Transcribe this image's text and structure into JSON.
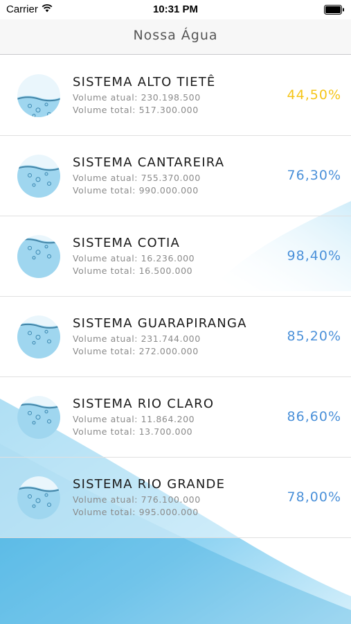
{
  "status_bar": {
    "carrier": "Carrier",
    "time": "10:31 PM",
    "icons": [
      "wifi-icon",
      "battery-icon"
    ]
  },
  "nav": {
    "title": "Nossa Água"
  },
  "colors": {
    "percent_normal": "#4a90d9",
    "percent_low": "#f5c518",
    "water": "#5bc0e8"
  },
  "systems": [
    {
      "name": "SISTEMA ALTO TIETÊ",
      "volume_atual": "Volume atual: 230.198.500",
      "volume_total": "Volume total: 517.300.000",
      "percent": "44,50%",
      "level": 0.445
    },
    {
      "name": "SISTEMA CANTAREIRA",
      "volume_atual": "Volume atual: 755.370.000",
      "volume_total": "Volume total: 990.000.000",
      "percent": "76,30%",
      "level": 0.763
    },
    {
      "name": "SISTEMA COTIA",
      "volume_atual": "Volume atual: 16.236.000",
      "volume_total": "Volume total: 16.500.000",
      "percent": "98,40%",
      "level": 0.984
    },
    {
      "name": "SISTEMA GUARAPIRANGA",
      "volume_atual": "Volume atual: 231.744.000",
      "volume_total": "Volume total: 272.000.000",
      "percent": "85,20%",
      "level": 0.852
    },
    {
      "name": "SISTEMA RIO CLARO",
      "volume_atual": "Volume atual: 11.864.200",
      "volume_total": "Volume total: 13.700.000",
      "percent": "86,60%",
      "level": 0.866
    },
    {
      "name": "SISTEMA RIO GRANDE",
      "volume_atual": "Volume atual: 776.100.000",
      "volume_total": "Volume total: 995.000.000",
      "percent": "78,00%",
      "level": 0.78
    }
  ]
}
